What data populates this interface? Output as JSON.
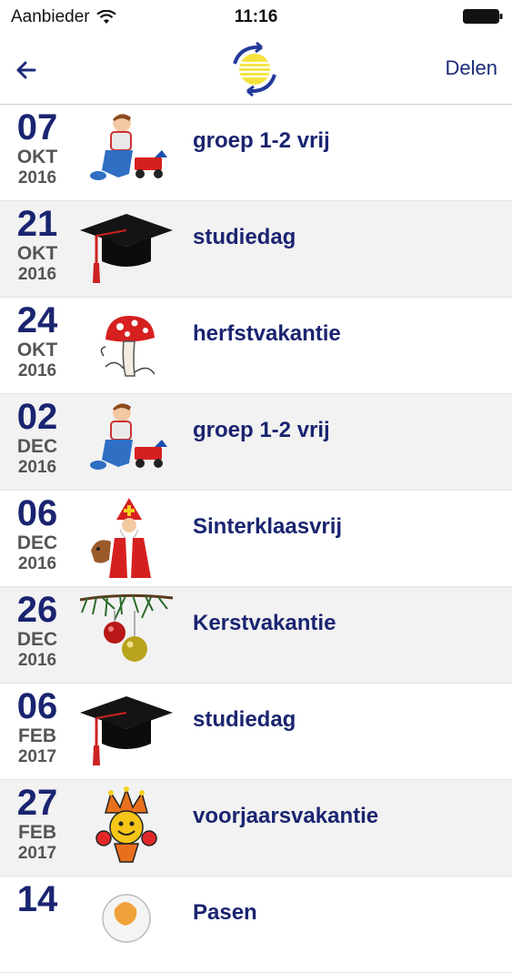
{
  "status_bar": {
    "carrier": "Aanbieder",
    "time": "11:16"
  },
  "nav": {
    "share_label": "Delen"
  },
  "events": [
    {
      "day": "07",
      "month": "OKT",
      "year": "2016",
      "title": "groep 1-2 vrij",
      "icon": "child-playing-icon"
    },
    {
      "day": "21",
      "month": "OKT",
      "year": "2016",
      "title": "studiedag",
      "icon": "graduation-cap-icon"
    },
    {
      "day": "24",
      "month": "OKT",
      "year": "2016",
      "title": "herfstvakantie",
      "icon": "mushroom-icon"
    },
    {
      "day": "02",
      "month": "DEC",
      "year": "2016",
      "title": "groep 1-2 vrij",
      "icon": "child-playing-icon"
    },
    {
      "day": "06",
      "month": "DEC",
      "year": "2016",
      "title": "Sinterklaasvrij",
      "icon": "sinterklaas-icon"
    },
    {
      "day": "26",
      "month": "DEC",
      "year": "2016",
      "title": "Kerstvakantie",
      "icon": "christmas-ornaments-icon"
    },
    {
      "day": "06",
      "month": "FEB",
      "year": "2017",
      "title": "studiedag",
      "icon": "graduation-cap-icon"
    },
    {
      "day": "27",
      "month": "FEB",
      "year": "2017",
      "title": "voorjaarsvakantie",
      "icon": "jester-icon"
    },
    {
      "day": "14",
      "month": "",
      "year": "",
      "title": "Pasen",
      "icon": "easter-icon"
    }
  ],
  "colors": {
    "accent": "#1a2470",
    "row_alt": "#f2f2f2"
  }
}
